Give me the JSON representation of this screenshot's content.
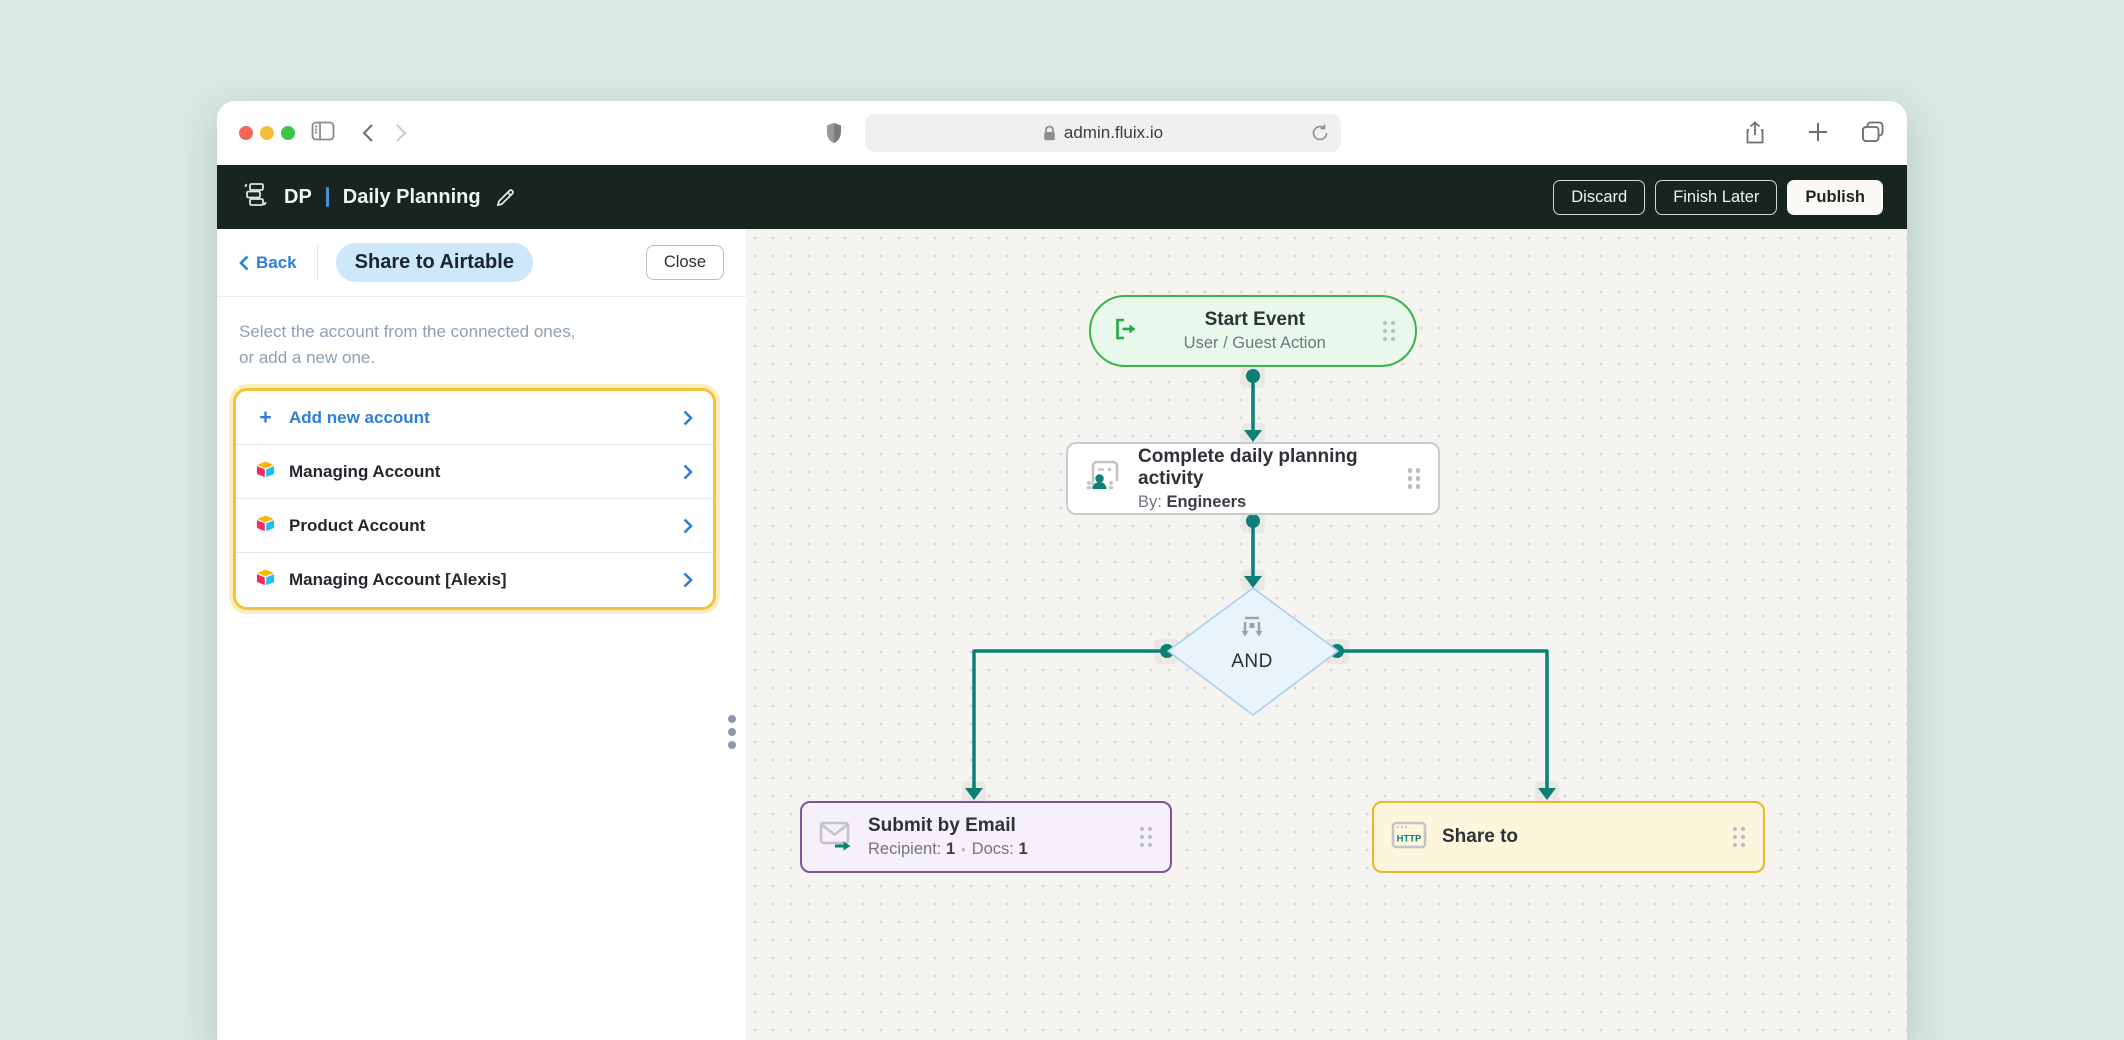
{
  "browser": {
    "url": "admin.fluix.io",
    "icons": [
      "traffic-lights",
      "sidebar-toggle",
      "back",
      "forward",
      "shield",
      "lock",
      "reload",
      "share",
      "new-tab",
      "tab-overview"
    ]
  },
  "header": {
    "initials": "DP",
    "title": "Daily Planning",
    "discard_label": "Discard",
    "finish_later_label": "Finish Later",
    "publish_label": "Publish"
  },
  "panel": {
    "back_label": "Back",
    "title": "Share to Airtable",
    "close_label": "Close",
    "description_line1": "Select the account from the connected ones,",
    "description_line2": "or add a new one.",
    "accounts": [
      {
        "label": "Add new account",
        "icon": "plus-icon"
      },
      {
        "label": "Managing Account",
        "icon": "airtable-icon"
      },
      {
        "label": "Product Account",
        "icon": "airtable-icon"
      },
      {
        "label": "Managing Account [Alexis]",
        "icon": "airtable-icon"
      }
    ]
  },
  "canvas": {
    "start": {
      "title": "Start Event",
      "subtitle": "User / Guest Action"
    },
    "activity": {
      "title": "Complete daily planning activity",
      "by_label": "By:",
      "by_value": "Engineers"
    },
    "gateway": {
      "label": "AND"
    },
    "email": {
      "title": "Submit by Email",
      "recipient_label": "Recipient:",
      "recipient_value": "1",
      "separator": "•",
      "docs_label": "Docs:",
      "docs_value": "1"
    },
    "share": {
      "title": "Share to",
      "icon_text": "HTTP"
    }
  },
  "colors": {
    "background_mint": "#d8e9e5",
    "appbar_dark": "#17241f",
    "accent_blue": "#2e7fd4",
    "connector_teal": "#0d8076",
    "start_green": "#3bb54a",
    "gateway_blue": "#a9ccf0",
    "email_purple": "#7a559e",
    "share_yellow": "#f0b42c",
    "list_border_yellow": "#f2c438"
  }
}
